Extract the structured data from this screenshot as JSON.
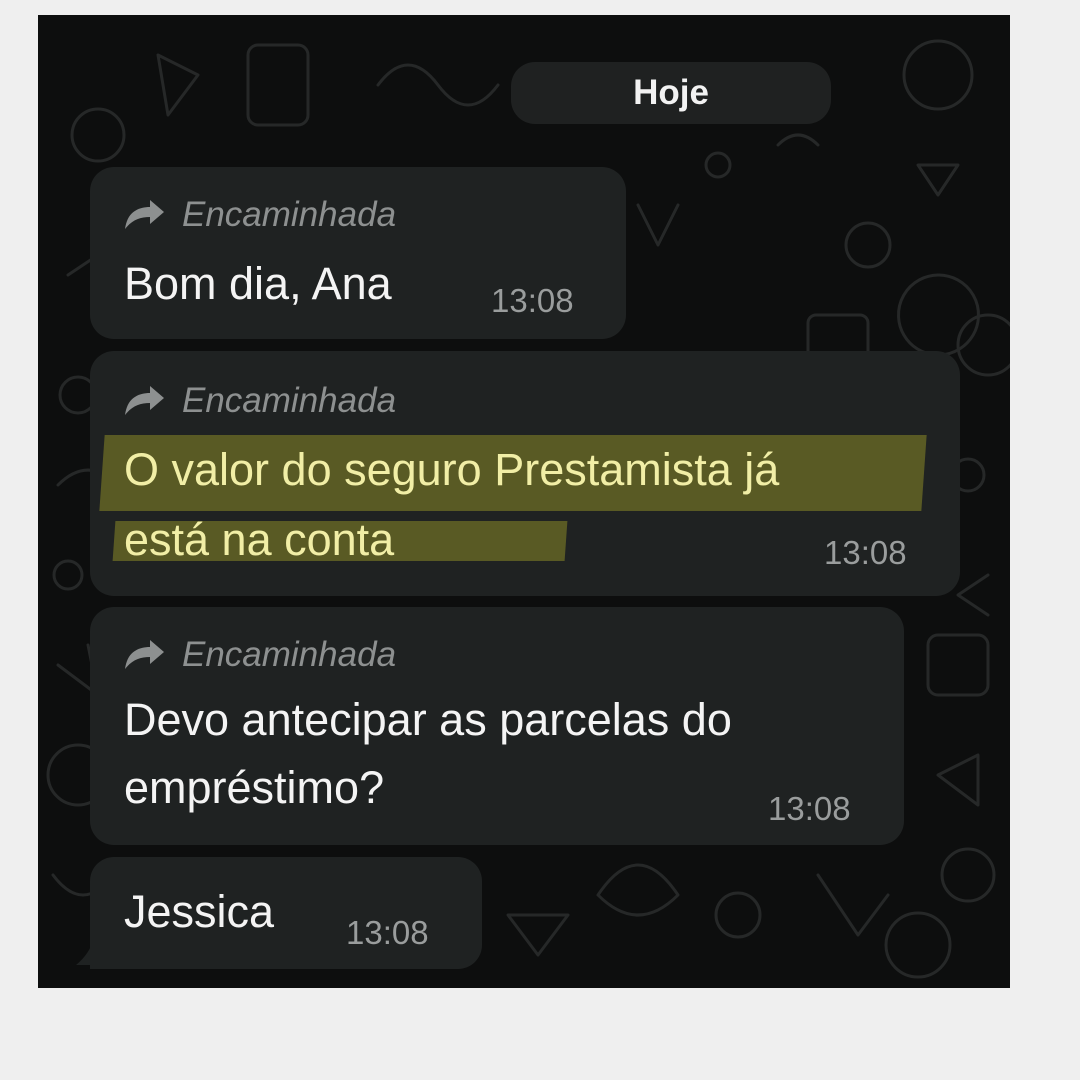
{
  "chat": {
    "date_label": "Hoje",
    "messages": [
      {
        "forwarded_label": "Encaminhada",
        "lines": [
          "Bom dia, Ana"
        ],
        "time": "13:08"
      },
      {
        "forwarded_label": "Encaminhada",
        "lines": [
          "O valor do seguro Prestamista já",
          "está na conta"
        ],
        "time": "13:08",
        "highlighted": true
      },
      {
        "forwarded_label": "Encaminhada",
        "lines": [
          "Devo antecipar as parcelas do",
          "empréstimo?"
        ],
        "time": "13:08"
      },
      {
        "lines": [
          "Jessica"
        ],
        "time": "13:08"
      }
    ]
  },
  "icons": {
    "forward": "forward-arrow-icon"
  },
  "colors": {
    "chat_background": "#0d0e0e",
    "bubble": "#1f2222",
    "highlight": "#595a24",
    "highlight_text": "#f1eea6",
    "meta_text": "#8d9090"
  }
}
